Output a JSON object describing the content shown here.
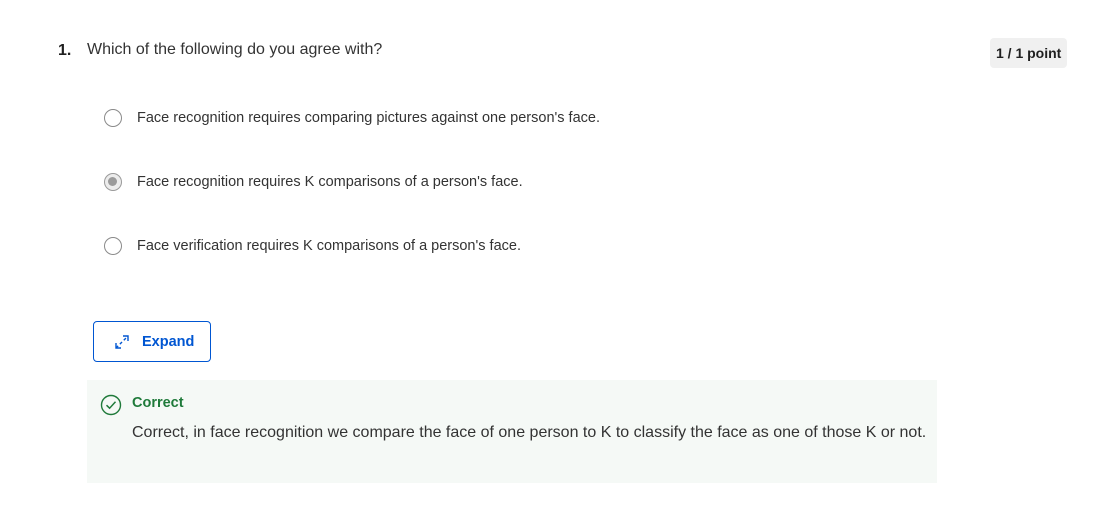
{
  "question": {
    "number": "1.",
    "text": "Which of the following do you agree with?",
    "points": "1 / 1 point"
  },
  "options": [
    {
      "label": "Face recognition requires comparing pictures against one person's face.",
      "selected": false
    },
    {
      "label": "Face recognition requires K comparisons of a person's face.",
      "selected": true
    },
    {
      "label": "Face verification requires K comparisons of a person's face.",
      "selected": false
    }
  ],
  "expand_button": {
    "label": "Expand",
    "icon": "expand-arrows-icon"
  },
  "feedback": {
    "icon": "check-circle-icon",
    "title": "Correct",
    "text": "Correct, in face recognition we compare the face of one person to K to classify the face as one of those K or not."
  },
  "colors": {
    "accent": "#0056d2",
    "success": "#1f7a3a",
    "feedback_bg": "#f5f9f6",
    "badge_bg": "#f0f0f0"
  }
}
